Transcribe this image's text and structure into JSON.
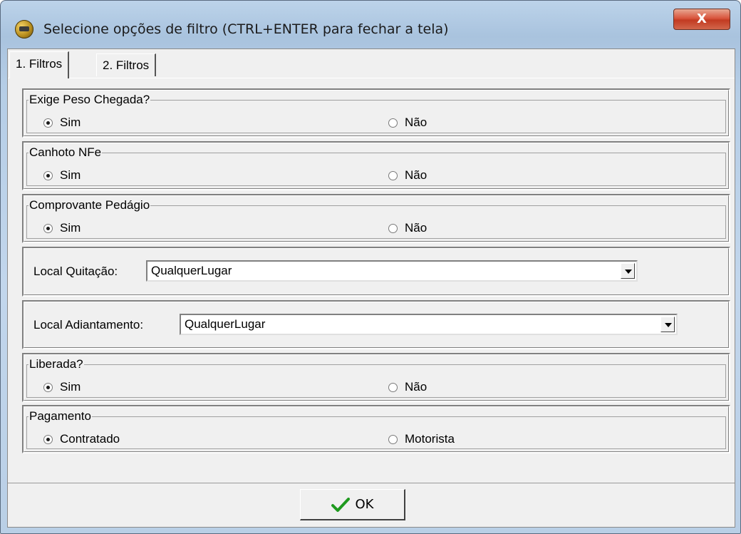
{
  "window": {
    "title": "Selecione opções de filtro (CTRL+ENTER para fechar a tela)",
    "close_label": "X"
  },
  "tabs": [
    {
      "label": "1. Filtros",
      "active": true
    },
    {
      "label": "2. Filtros",
      "active": false
    }
  ],
  "groups": {
    "peso": {
      "legend": "Exige Peso Chegada?",
      "opt1": "Sim",
      "opt2": "Não",
      "selected": "Sim"
    },
    "canhoto": {
      "legend": "Canhoto NFe",
      "opt1": "Sim",
      "opt2": "Não",
      "selected": "Sim"
    },
    "pedagio": {
      "legend": "Comprovante Pedágio",
      "opt1": "Sim",
      "opt2": "Não",
      "selected": "Sim"
    },
    "liberada": {
      "legend": "Liberada?",
      "opt1": "Sim",
      "opt2": "Não",
      "selected": "Sim"
    },
    "pagamento": {
      "legend": "Pagamento",
      "opt1": "Contratado",
      "opt2": "Motorista",
      "selected": "Contratado"
    }
  },
  "quitacao": {
    "label": "Local Quitação:",
    "value": "QualquerLugar"
  },
  "adiantamento": {
    "label": "Local Adiantamento:",
    "value": "QualquerLugar"
  },
  "ok": {
    "label": "OK",
    "icon": "checkmark-icon",
    "color": "#1f9a1f"
  }
}
